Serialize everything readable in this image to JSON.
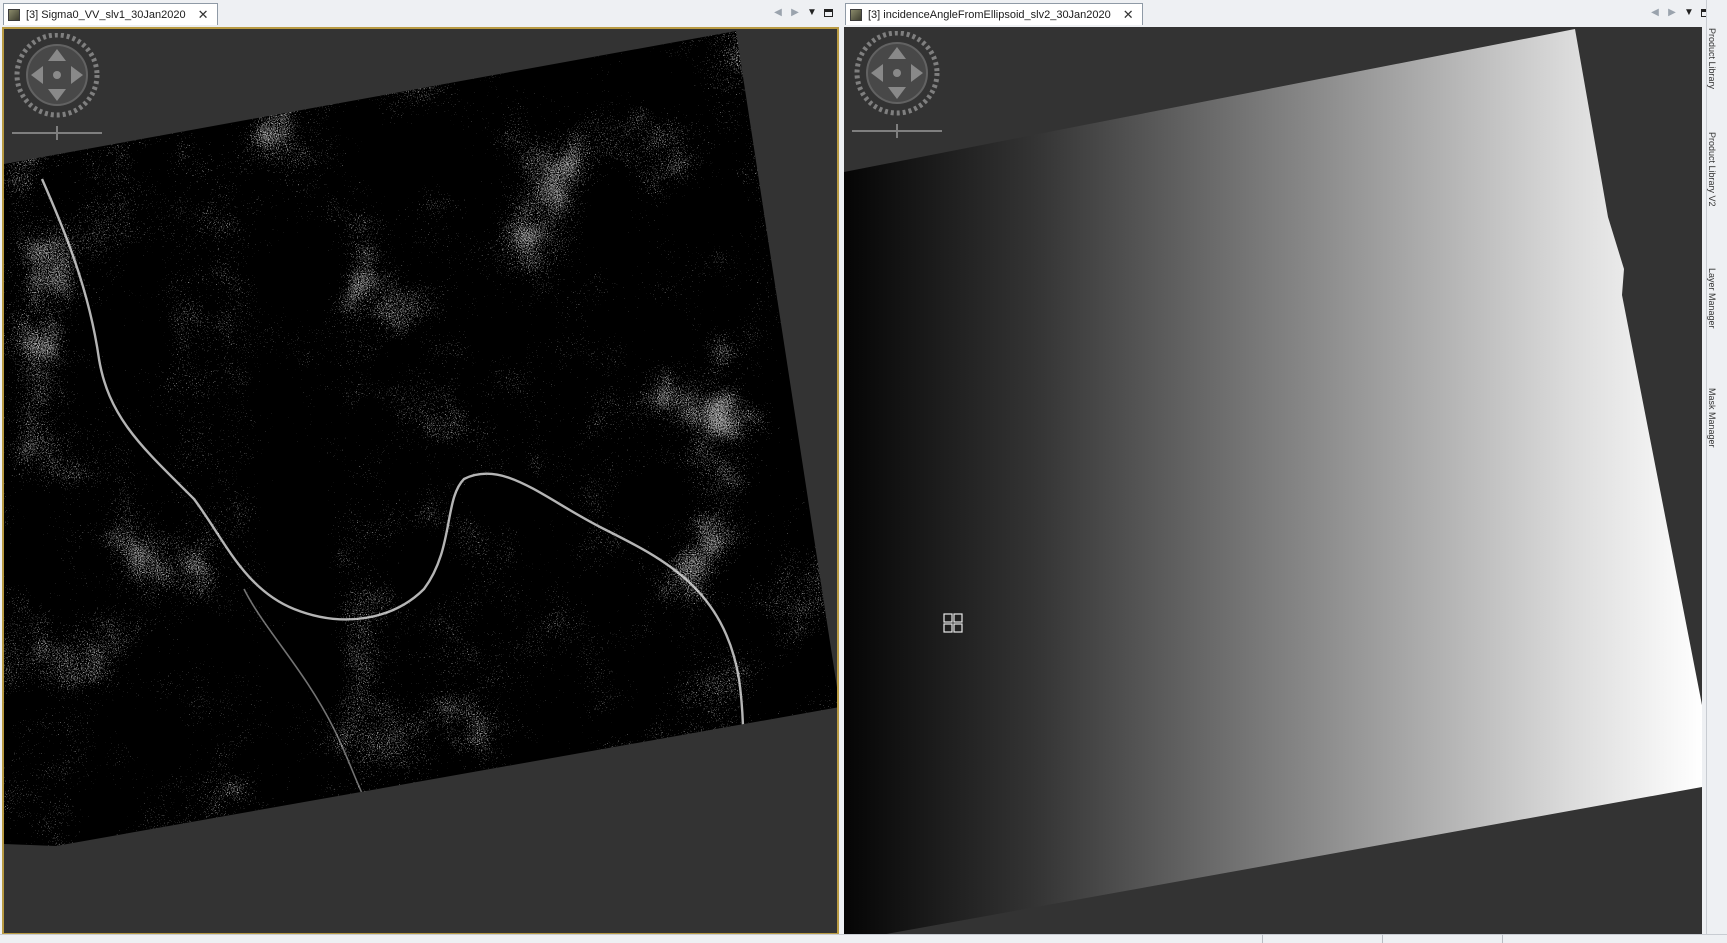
{
  "left_pane": {
    "tab_label": "[3] Sigma0_VV_slv1_30Jan2020",
    "close_glyph": "✕",
    "tab_icon": "image-view-icon"
  },
  "right_pane": {
    "tab_label": "[3] incidenceAngleFromEllipsoid_slv2_30Jan2020",
    "close_glyph": "✕",
    "tab_icon": "image-view-icon"
  },
  "tab_controls": {
    "prev_glyph": "◀",
    "next_glyph": "▶",
    "list_glyph": "▼"
  },
  "right_sidebar": {
    "items": [
      "Product Library",
      "Product Library V2",
      "Layer Manager",
      "Mask Manager"
    ]
  },
  "colors": {
    "view_background": "#333333",
    "selected_view_border": "#b89a42",
    "tab_border": "#8f9aa6"
  }
}
